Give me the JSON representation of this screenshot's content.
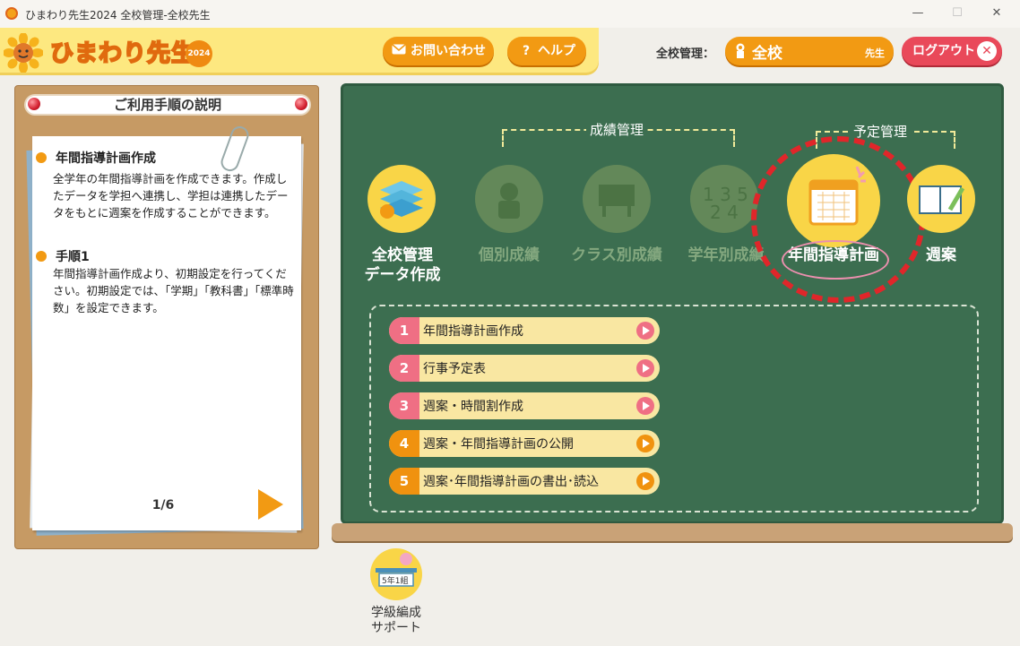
{
  "window": {
    "title": "ひまわり先生2024 全校管理-全校先生",
    "min": "—",
    "max": "☐",
    "close": "✕"
  },
  "header": {
    "brand": "ひまわり先生",
    "year": "2024",
    "contact_label": "お問い合わせ",
    "help_label": "ヘルプ",
    "help_icon": "?",
    "scope_label": "全校管理：",
    "school": "全校",
    "role": "先生",
    "logout_label": "ログアウト",
    "logout_icon": "✕"
  },
  "guide": {
    "title": "ご利用手順の説明",
    "sections": [
      {
        "heading": "年間指導計画作成",
        "text": "全学年の年間指導計画を作成できます。作成したデータを学担へ連携し、学担は連携したデータをもとに週案を作成することができます。"
      },
      {
        "heading": "手順1",
        "text": "年間指導計画作成より、初期設定を行ってください。初期設定では、「学期」「教科書」「標準時数」を設定できます。"
      }
    ],
    "page": "1/6"
  },
  "board": {
    "group_grades": "成績管理",
    "group_schedule": "予定管理",
    "menu": [
      {
        "label": "全校管理\nデータ作成",
        "active": true
      },
      {
        "label": "個別成績",
        "active": false
      },
      {
        "label": "クラス別成績",
        "active": false
      },
      {
        "label": "学年別成績",
        "active": false
      },
      {
        "label": "年間指導計画",
        "active": true
      },
      {
        "label": "週案",
        "active": true
      }
    ],
    "submenu": [
      {
        "num": "1",
        "label": "年間指導計画作成",
        "color": "#ef6f84"
      },
      {
        "num": "2",
        "label": "行事予定表",
        "color": "#ef6f84"
      },
      {
        "num": "3",
        "label": "週案・時間割作成",
        "color": "#ef6f84"
      },
      {
        "num": "4",
        "label": "週案・年間指導計画の公開",
        "color": "#f0920f"
      },
      {
        "num": "5",
        "label": "週案･年間指導計画の書出･読込",
        "color": "#f0920f"
      }
    ]
  },
  "tool": {
    "label": "学級編成\nサポート",
    "badge": "5年1組"
  }
}
